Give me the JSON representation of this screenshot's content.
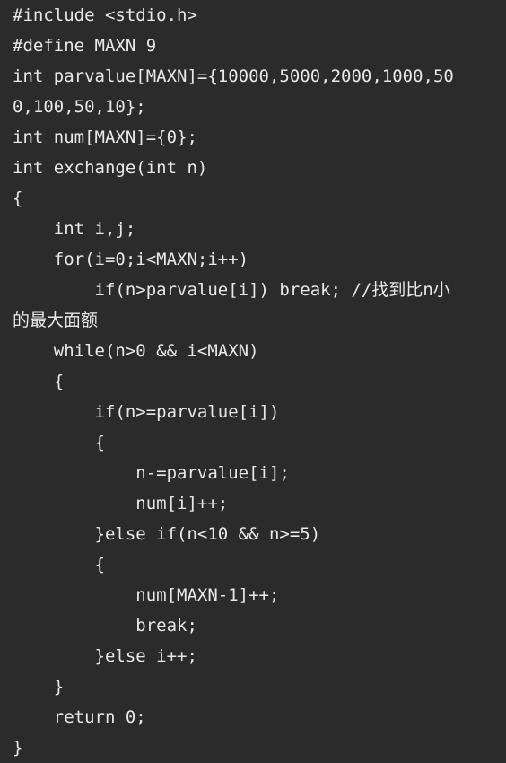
{
  "editor": {
    "lines": [
      "#include <stdio.h>",
      "#define MAXN 9",
      "int parvalue[MAXN]={10000,5000,2000,1000,50",
      "0,100,50,10};",
      "int num[MAXN]={0};",
      "int exchange(int n)",
      "{",
      "    int i,j;",
      "    for(i=0;i<MAXN;i++)",
      "        if(n>parvalue[i]) break; //找到比n小",
      "的最大面额",
      "    while(n>0 && i<MAXN)",
      "    {",
      "        if(n>=parvalue[i])",
      "        {",
      "            n-=parvalue[i];",
      "            num[i]++;",
      "        }else if(n<10 && n>=5)",
      "        {",
      "            num[MAXN-1]++;",
      "            break;",
      "        }else i++;",
      "    }",
      "    return 0;",
      "}"
    ],
    "background_color": "#2b2b2b",
    "text_color": "#e8e8e8"
  }
}
